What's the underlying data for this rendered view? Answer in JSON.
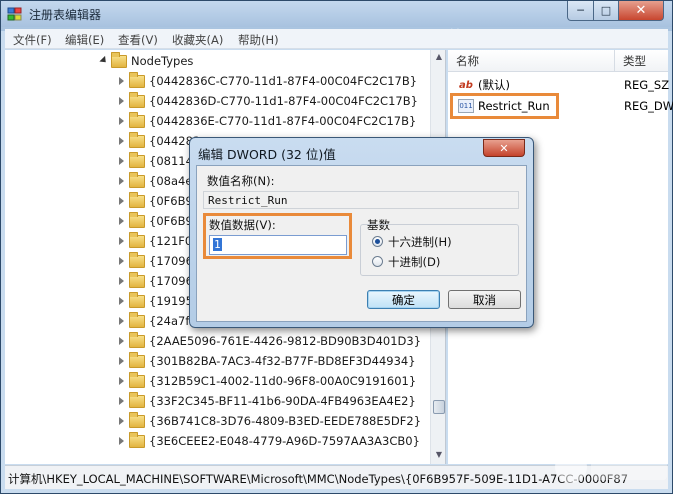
{
  "window": {
    "title": "注册表编辑器",
    "controls": {
      "min": "─",
      "max": "□",
      "close": "✕"
    }
  },
  "menu": [
    "文件(F)",
    "编辑(E)",
    "查看(V)",
    "收藏夹(A)",
    "帮助(H)"
  ],
  "watermark": "三联网 3LIAN.COM",
  "tree": {
    "root_label": "NodeTypes",
    "items": [
      "{0442836C-C770-11d1-87F4-00C04FC2C17B}",
      "{0442836D-C770-11d1-87F4-00C04FC2C17B}",
      "{0442836E-C770-11d1-87F4-00C04FC2C17B}",
      "{044283",
      "{08114",
      "{08a4e",
      "{0F6B9",
      "{0F6B9",
      "{121F0",
      "{17096",
      "{17096",
      "{19195",
      "{24a7f",
      "{2AAE5096-761E-4426-9812-BD90B3D401D3}",
      "{301B82BA-7AC3-4f32-B77F-BD8EF3D44934}",
      "{312B59C1-4002-11d0-96F8-00A0C9191601}",
      "{33F2C345-BF11-41b6-90DA-4FB4963EA4E2}",
      "{36B741C8-3D76-4809-B3ED-EEDE788E5DF2}",
      "{3E6CEEE2-E048-4779-A96D-7597AA3A3CB0}"
    ]
  },
  "values_pane": {
    "col_name": "名称",
    "col_type": "类型",
    "rows": [
      {
        "name": "(默认)",
        "type": "REG_SZ",
        "icon": "string-value-icon"
      },
      {
        "name": "Restrict_Run",
        "type": "REG_DW",
        "icon": "dword-value-icon"
      }
    ]
  },
  "status_path": "计算机\\HKEY_LOCAL_MACHINE\\SOFTWARE\\Microsoft\\MMC\\NodeTypes\\{0F6B957F-509E-11D1-A7CC-0000F87",
  "dialog": {
    "title": "编辑 DWORD (32 位)值",
    "close": "✕",
    "name_label": "数值名称(N):",
    "name_value": "Restrict_Run",
    "data_label": "数值数据(V):",
    "data_value": "1",
    "base_label": "基数",
    "hex_label": "十六进制(H)",
    "dec_label": "十进制(D)",
    "selected_base": "hex",
    "ok": "确定",
    "cancel": "取消"
  },
  "colors": {
    "highlight": "#e98a3a",
    "selection": "#3375d6"
  }
}
